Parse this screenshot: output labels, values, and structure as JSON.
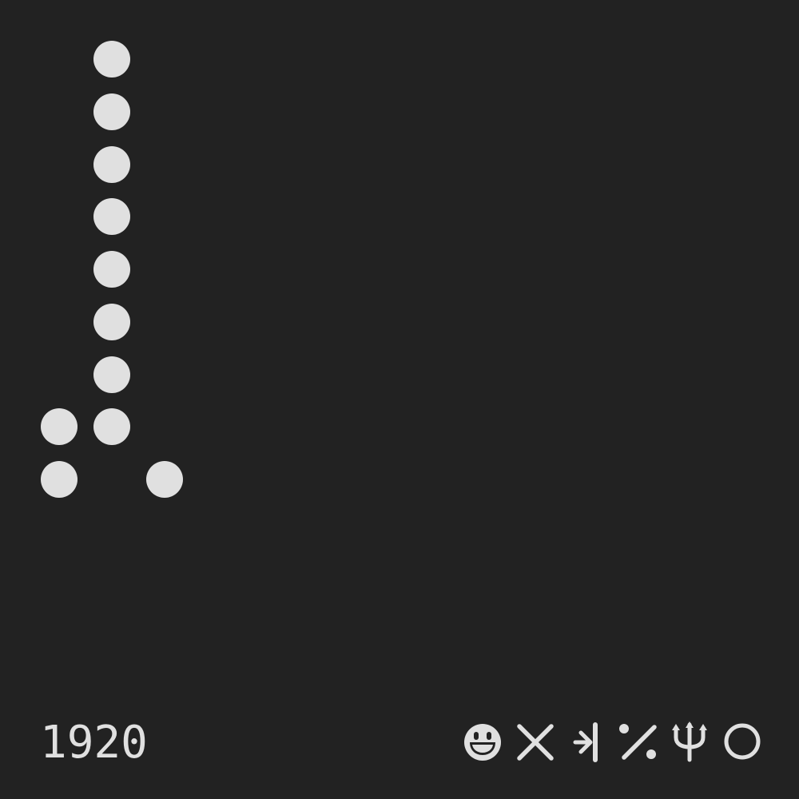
{
  "colors": {
    "background": "#222222",
    "foreground": "#e0e0e0"
  },
  "dot_grid": {
    "columns": 3,
    "rows": 9,
    "filled": [
      [
        0,
        1,
        0
      ],
      [
        0,
        1,
        0
      ],
      [
        0,
        1,
        0
      ],
      [
        0,
        1,
        0
      ],
      [
        0,
        1,
        0
      ],
      [
        0,
        1,
        0
      ],
      [
        0,
        1,
        0
      ],
      [
        1,
        1,
        0
      ],
      [
        1,
        0,
        1
      ]
    ]
  },
  "footer": {
    "number": "1920",
    "symbols": [
      "grinning-face-icon",
      "cross-x-icon",
      "arrow-to-bar-icon",
      "percent-slash-icon",
      "trident-psi-icon",
      "ring-circle-icon"
    ]
  }
}
